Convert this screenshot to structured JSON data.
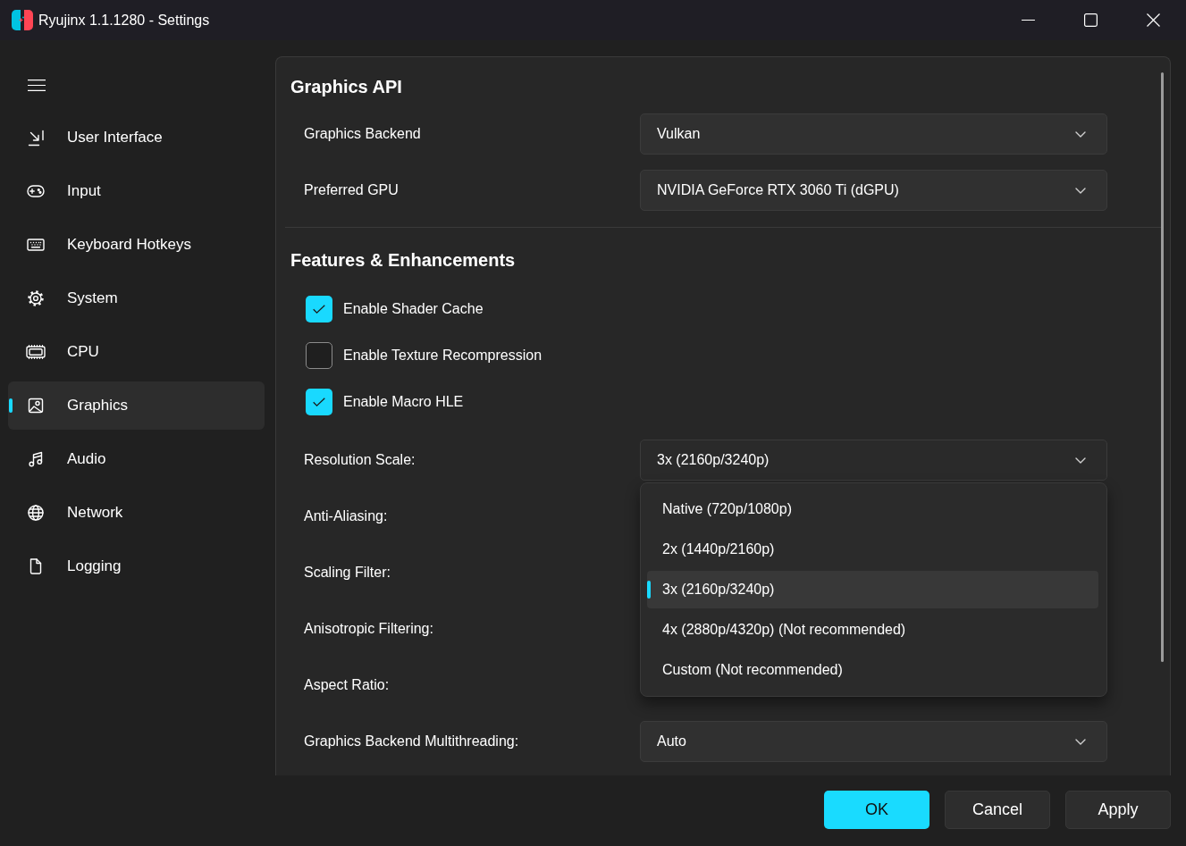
{
  "window": {
    "title": "Ryujinx 1.1.1280 - Settings"
  },
  "sidebar": {
    "items": [
      {
        "label": "User Interface",
        "selected": false
      },
      {
        "label": "Input",
        "selected": false
      },
      {
        "label": "Keyboard Hotkeys",
        "selected": false
      },
      {
        "label": "System",
        "selected": false
      },
      {
        "label": "CPU",
        "selected": false
      },
      {
        "label": "Graphics",
        "selected": true
      },
      {
        "label": "Audio",
        "selected": false
      },
      {
        "label": "Network",
        "selected": false
      },
      {
        "label": "Logging",
        "selected": false
      }
    ]
  },
  "sections": [
    {
      "heading": "Graphics API",
      "rows": [
        {
          "kind": "dropdown",
          "label": "Graphics Backend",
          "value": "Vulkan"
        },
        {
          "kind": "dropdown",
          "label": "Preferred GPU",
          "value": "NVIDIA GeForce RTX 3060 Ti (dGPU)"
        }
      ]
    },
    {
      "heading": "Features & Enhancements",
      "rows": [
        {
          "kind": "checkbox",
          "label": "Enable Shader Cache",
          "checked": true
        },
        {
          "kind": "checkbox",
          "label": "Enable Texture Recompression",
          "checked": false
        },
        {
          "kind": "checkbox",
          "label": "Enable Macro HLE",
          "checked": true
        },
        {
          "kind": "dropdown",
          "label": "Resolution Scale:",
          "value": "3x (2160p/3240p)",
          "expanded": true,
          "options": [
            {
              "label": "Native (720p/1080p)",
              "selected": false
            },
            {
              "label": "2x (1440p/2160p)",
              "selected": false
            },
            {
              "label": "3x (2160p/3240p)",
              "selected": true
            },
            {
              "label": "4x (2880p/4320p) (Not recommended)",
              "selected": false
            },
            {
              "label": "Custom (Not recommended)",
              "selected": false
            }
          ]
        },
        {
          "kind": "dropdown",
          "label": "Anti-Aliasing:"
        },
        {
          "kind": "dropdown",
          "label": "Scaling Filter:"
        },
        {
          "kind": "dropdown",
          "label": "Anisotropic Filtering:"
        },
        {
          "kind": "dropdown",
          "label": "Aspect Ratio:"
        },
        {
          "kind": "dropdown",
          "label": "Graphics Backend Multithreading:",
          "value": "Auto"
        }
      ]
    }
  ],
  "buttons": [
    {
      "label": "OK",
      "kind": "primary"
    },
    {
      "label": "Cancel",
      "kind": "secondary"
    },
    {
      "label": "Apply",
      "kind": "secondary"
    }
  ]
}
